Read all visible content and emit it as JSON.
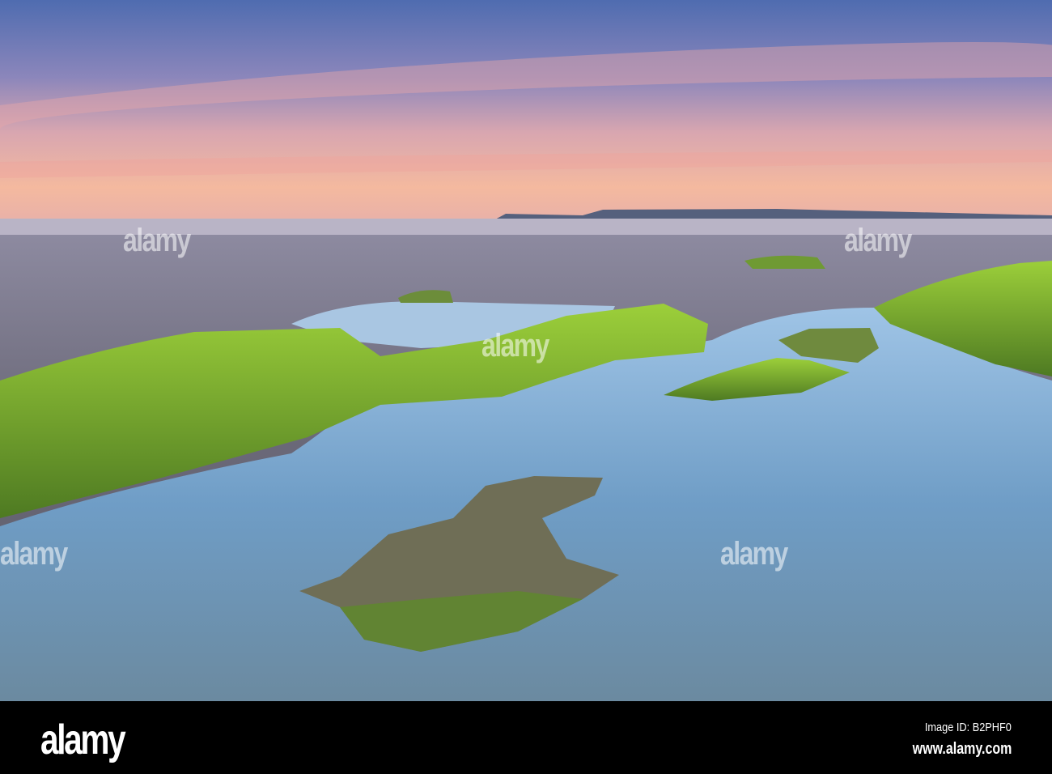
{
  "photo": {
    "subject": "tide pools with green seaweed-covered rocks on sandy beach at sunset",
    "colors": {
      "sky_top": "#5a74b6",
      "sky_glow": "#f2b7a0",
      "sand": "#6f6f80",
      "water": "#7fa9cc",
      "moss": "#7fae2a"
    }
  },
  "watermark": {
    "text": "alamy"
  },
  "footer": {
    "logo": "alamy",
    "image_id": "Image ID: B2PHF0",
    "url": "www.alamy.com"
  }
}
